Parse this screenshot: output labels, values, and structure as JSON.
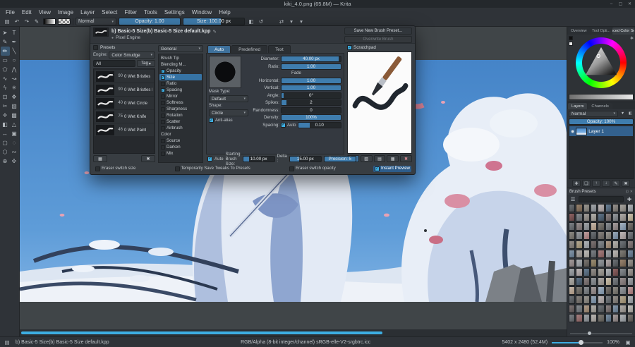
{
  "colors": {
    "accent": "#3daee2",
    "selection": "#2d5c8a",
    "slider_fill": "#3f7dae"
  },
  "icons": {
    "chevron": "▾",
    "pencil": "✎",
    "dot": "●",
    "gear": "✱",
    "float": "⊡",
    "close": "✕",
    "eye": "◉",
    "funnel": "☰",
    "plus": "✚",
    "status_brush": "▤",
    "canvas_mode": "▣"
  },
  "window": {
    "title": "kiki_4.0.png (65.8M) — Krita",
    "buttons": [
      "–",
      "▢",
      "✕"
    ]
  },
  "menu": {
    "items": [
      "File",
      "Edit",
      "View",
      "Image",
      "Layer",
      "Select",
      "Filter",
      "Tools",
      "Settings",
      "Window",
      "Help"
    ]
  },
  "toolbar": {
    "left_icons": [
      {
        "name": "save-icon",
        "glyph": "▤"
      },
      {
        "name": "undo-icon",
        "glyph": "↶"
      },
      {
        "name": "redo-icon",
        "glyph": "↷"
      },
      {
        "name": "edit-brush-settings-icon",
        "glyph": "✎"
      }
    ],
    "blend_label": "Normal",
    "opacity_text": "Opacity: 1.00",
    "opacity_fill": 1,
    "size_text": "Size: 100.00 px",
    "size_fill": 0.62,
    "right_icons": [
      {
        "name": "eraser-mode-icon",
        "glyph": "◧"
      },
      {
        "name": "reload-preset-icon",
        "glyph": "↺"
      }
    ],
    "far_icons": [
      {
        "name": "mirror-horizontal-icon",
        "glyph": "⇄"
      },
      {
        "name": "mirror-dropdown-icon",
        "glyph": "▾"
      },
      {
        "name": "wrap-around-dropdown-icon",
        "glyph": "▾"
      }
    ]
  },
  "toolbox": {
    "tools": [
      {
        "name": "tool-select-shapes",
        "glyph": "➤"
      },
      {
        "name": "tool-text",
        "glyph": "T"
      },
      {
        "name": "tool-edit-shapes",
        "glyph": "✎"
      },
      {
        "name": "tool-calligraphy",
        "glyph": "✒"
      },
      {
        "name": "tool-freehand-brush",
        "glyph": "✏",
        "active": true
      },
      {
        "name": "tool-line",
        "glyph": "╲"
      },
      {
        "name": "tool-rectangle",
        "glyph": "▭"
      },
      {
        "name": "tool-ellipse",
        "glyph": "○"
      },
      {
        "name": "tool-polygon",
        "glyph": "⬠"
      },
      {
        "name": "tool-polyline",
        "glyph": "⋀"
      },
      {
        "name": "tool-bezier",
        "glyph": "∿"
      },
      {
        "name": "tool-freehand-path",
        "glyph": "↝"
      },
      {
        "name": "tool-dynamic-brush",
        "glyph": "ϟ"
      },
      {
        "name": "tool-multibrush",
        "glyph": "✳"
      },
      {
        "name": "tool-transform",
        "glyph": "⊡"
      },
      {
        "name": "tool-move",
        "glyph": "✥"
      },
      {
        "name": "tool-crop",
        "glyph": "✂"
      },
      {
        "name": "tool-gradient",
        "glyph": "▧"
      },
      {
        "name": "tool-color-picker",
        "glyph": "✛"
      },
      {
        "name": "tool-pattern",
        "glyph": "▩"
      },
      {
        "name": "tool-fill",
        "glyph": "◧"
      },
      {
        "name": "tool-assistants",
        "glyph": "△"
      },
      {
        "name": "tool-measure",
        "glyph": "↔"
      },
      {
        "name": "tool-reference",
        "glyph": "▣"
      },
      {
        "name": "tool-rect-select",
        "glyph": "▢"
      },
      {
        "name": "tool-ellipse-select",
        "glyph": "◌"
      },
      {
        "name": "tool-polygon-select",
        "glyph": "⬡"
      },
      {
        "name": "tool-freehand-select",
        "glyph": "∾"
      },
      {
        "name": "tool-zoom",
        "glyph": "⊕"
      },
      {
        "name": "tool-pan",
        "glyph": "✣"
      }
    ]
  },
  "brush_editor": {
    "title": "b) Basic-5 Size(b) Basic-5 Size default.kpp",
    "engine": "Pixel Engine",
    "save_button": "Save New Brush Preset...",
    "overwrite_button": "Overwrite Brush",
    "presets": {
      "toggle_label": "Presets",
      "engine_label": "Engine:",
      "engine_value": "Color Smudge",
      "filter_value": "All",
      "tag_button": "Tag",
      "items": [
        {
          "size": "90",
          "name": "0 Wet Bristles"
        },
        {
          "size": "90",
          "name": "0 Wet Bristles Rough"
        },
        {
          "size": "40",
          "name": "0 Wet Circle"
        },
        {
          "size": "75",
          "name": "0 Wet Knife"
        },
        {
          "size": "46",
          "name": "0 Wet Paint"
        }
      ]
    },
    "list_buttons": [
      {
        "name": "preset-view-mode-button",
        "glyph": "▦"
      },
      {
        "name": "preset-delete-button",
        "glyph": "✖"
      }
    ],
    "tree": {
      "header": "General",
      "selected_index": 3,
      "items": [
        {
          "label": "Brush Tip",
          "check": null
        },
        {
          "label": "Blending M...",
          "check": null
        },
        {
          "label": "Opacity",
          "check": true
        },
        {
          "label": "Size",
          "check": true
        },
        {
          "label": "Ratio",
          "check": false
        },
        {
          "label": "Spacing",
          "check": true
        },
        {
          "label": "Mirror",
          "check": false
        },
        {
          "label": "Softness",
          "check": false
        },
        {
          "label": "Sharpness",
          "check": false
        },
        {
          "label": "Rotation",
          "check": false
        },
        {
          "label": "Scatter",
          "check": false
        },
        {
          "label": "Airbrush",
          "check": false
        },
        {
          "label": "Color",
          "check": null
        },
        {
          "label": "Source",
          "check": false
        },
        {
          "label": "Darken",
          "check": false
        },
        {
          "label": "Mix",
          "check": false
        }
      ]
    },
    "tabs": [
      {
        "label": "Auto",
        "active": true
      },
      {
        "label": "Predefined"
      },
      {
        "label": "Text"
      }
    ],
    "mask_type_label": "Mask Type:",
    "mask_type_value": "Default",
    "shape_label": "Shape:",
    "shape_value": "Circle",
    "antialias_label": "Anti-alias",
    "sliders_top": [
      {
        "label": "Diameter:",
        "value": "40.00 px",
        "fill": 0.97
      },
      {
        "label": "Ratio:",
        "value": "1.00",
        "fill": 1
      }
    ],
    "fade_label": "Fade",
    "sliders_fade": [
      {
        "label": "Horizontal:",
        "value": "1.00",
        "fill": 1
      },
      {
        "label": "Vertical:",
        "value": "1.00",
        "fill": 1
      }
    ],
    "sliders_main": [
      {
        "label": "Angle:",
        "value": "0°",
        "fill": 0.03
      },
      {
        "label": "Spikes:",
        "value": "2",
        "fill": 0.08
      },
      {
        "label": "Randomness:",
        "value": "0",
        "fill": 0
      },
      {
        "label": "Density:",
        "value": "100%",
        "fill": 1
      },
      {
        "label": "Spacing:",
        "value": "0.10",
        "fill": 0.28,
        "auto_label": "Auto",
        "auto_checked": true
      }
    ],
    "footer": {
      "auto_label": "Auto",
      "auto_checked": true,
      "start_label": "Starting Brush Size:",
      "start_value": "10.00 px",
      "start_fill": 0.2,
      "delta_label": "Delta :",
      "delta_value": "15.00 px",
      "delta_fill": 0.3,
      "precision_value": "Precision: 5",
      "precision_fill": 1
    },
    "scratchpad": {
      "label": "Scratchpad",
      "buttons": [
        {
          "name": "scratchpad-paint-button",
          "glyph": "✎",
          "active": true
        },
        {
          "name": "scratchpad-fill-gradient-button",
          "glyph": "▧"
        },
        {
          "name": "scratchpad-fill-background-button",
          "glyph": "▤"
        },
        {
          "name": "scratchpad-fill-layer-button",
          "glyph": "▦"
        },
        {
          "name": "scratchpad-clear-button",
          "glyph": "✖",
          "danger": true
        }
      ]
    },
    "options": [
      {
        "label": "Eraser switch size",
        "on": false
      },
      {
        "label": "Temporarily Save Tweaks To Presets",
        "on": false
      },
      {
        "label": "Eraser switch opacity",
        "on": false
      },
      {
        "label": "Instant Preview",
        "on": true,
        "highlight": true
      }
    ]
  },
  "right_dock": {
    "tabs": [
      {
        "label": "Overview"
      },
      {
        "label": "Tool Opti..."
      },
      {
        "label": "Advanced Color Selector",
        "active": true
      }
    ],
    "dock_icons": [
      {
        "name": "dock-float-icon",
        "glyph": "⊡"
      },
      {
        "name": "dock-close-icon",
        "glyph": "✕"
      }
    ],
    "layers": {
      "tabs": [
        {
          "label": "Layers",
          "active": true
        },
        {
          "label": "Channels"
        }
      ],
      "blend_value": "Normal",
      "row_icons": [
        {
          "name": "layer-filter-icon",
          "glyph": "▼"
        },
        {
          "name": "layer-lock-icon",
          "glyph": "◧"
        }
      ],
      "opacity_text": "Opacity: 100%",
      "opacity_fill": 1,
      "layer_name": "Layer 1",
      "buttons": [
        {
          "name": "add-layer-button",
          "glyph": "✚"
        },
        {
          "name": "duplicate-layer-button",
          "glyph": "❏"
        },
        {
          "name": "move-layer-up-button",
          "glyph": "↑"
        },
        {
          "name": "move-layer-down-button",
          "glyph": "↓"
        },
        {
          "name": "layer-properties-button",
          "glyph": "✎"
        },
        {
          "name": "delete-layer-button",
          "glyph": "✖"
        }
      ]
    },
    "brush_presets": {
      "title": "Brush Presets",
      "grid_cols": 9,
      "grid_rows": 13,
      "toolbar_icons": [
        {
          "name": "presets-menu-icon",
          "glyph": "☰"
        },
        {
          "name": "add-preset-icon",
          "glyph": "✚"
        }
      ]
    }
  },
  "statusbar": {
    "preset": "b) Basic-5 Size(b) Basic-5 Size default.kpp",
    "profile": "RGB/Alpha (8-bit integer/channel)  sRGB-elle-V2-srgbtrc.icc",
    "dimensions": "5402 x 2480 (52.4M)",
    "zoom": "100%"
  }
}
